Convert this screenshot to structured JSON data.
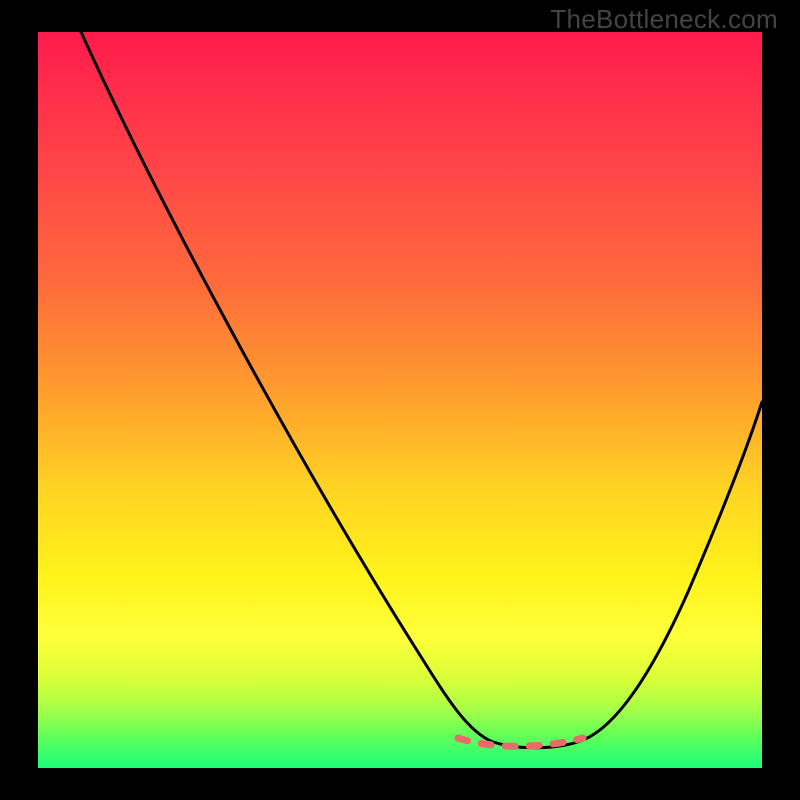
{
  "watermark": "TheBottleneck.com",
  "colors": {
    "top": "#ff1a4d",
    "mid": "#ffd324",
    "bottom": "#1aff7a",
    "curve": "#000000",
    "dashed": "#e86a6a"
  },
  "chart_data": {
    "type": "line",
    "title": "",
    "xlabel": "",
    "ylabel": "",
    "xlim": [
      0,
      100
    ],
    "ylim": [
      0,
      100
    ],
    "series": [
      {
        "name": "bottleneck-curve",
        "x": [
          6,
          10,
          20,
          30,
          40,
          50,
          55,
          58,
          62,
          66,
          70,
          74,
          78,
          84,
          92,
          100
        ],
        "y": [
          100,
          92,
          75,
          58,
          42,
          25,
          14,
          8,
          3,
          1,
          1,
          1,
          3,
          9,
          22,
          42
        ]
      }
    ],
    "annotations": [
      {
        "name": "optimal-range-dashes",
        "x_range": [
          58,
          74
        ],
        "y": 3,
        "style": "dashed",
        "color": "#e86a6a"
      }
    ]
  }
}
